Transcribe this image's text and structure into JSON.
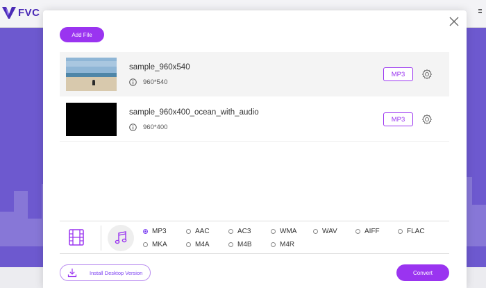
{
  "app": {
    "brand": "FVC"
  },
  "dialog": {
    "add_file_label": "Add File",
    "files": [
      {
        "name": "sample_960x540",
        "resolution": "960*540",
        "format": "MP3"
      },
      {
        "name": "sample_960x400_ocean_with_audio",
        "resolution": "960*400",
        "format": "MP3"
      }
    ],
    "formats": {
      "selected": "MP3",
      "options": [
        "MP3",
        "AAC",
        "AC3",
        "WMA",
        "WAV",
        "AIFF",
        "FLAC",
        "MKA",
        "M4A",
        "M4B",
        "M4R"
      ]
    },
    "install_label": "Install Desktop Version",
    "convert_label": "Convert"
  },
  "colors": {
    "accent": "#9a34f0",
    "background": "#6d59cf"
  },
  "icons": [
    "fvc-logo-icon",
    "close-icon",
    "info-icon",
    "gear-icon",
    "film-icon",
    "music-note-icon",
    "download-icon"
  ]
}
